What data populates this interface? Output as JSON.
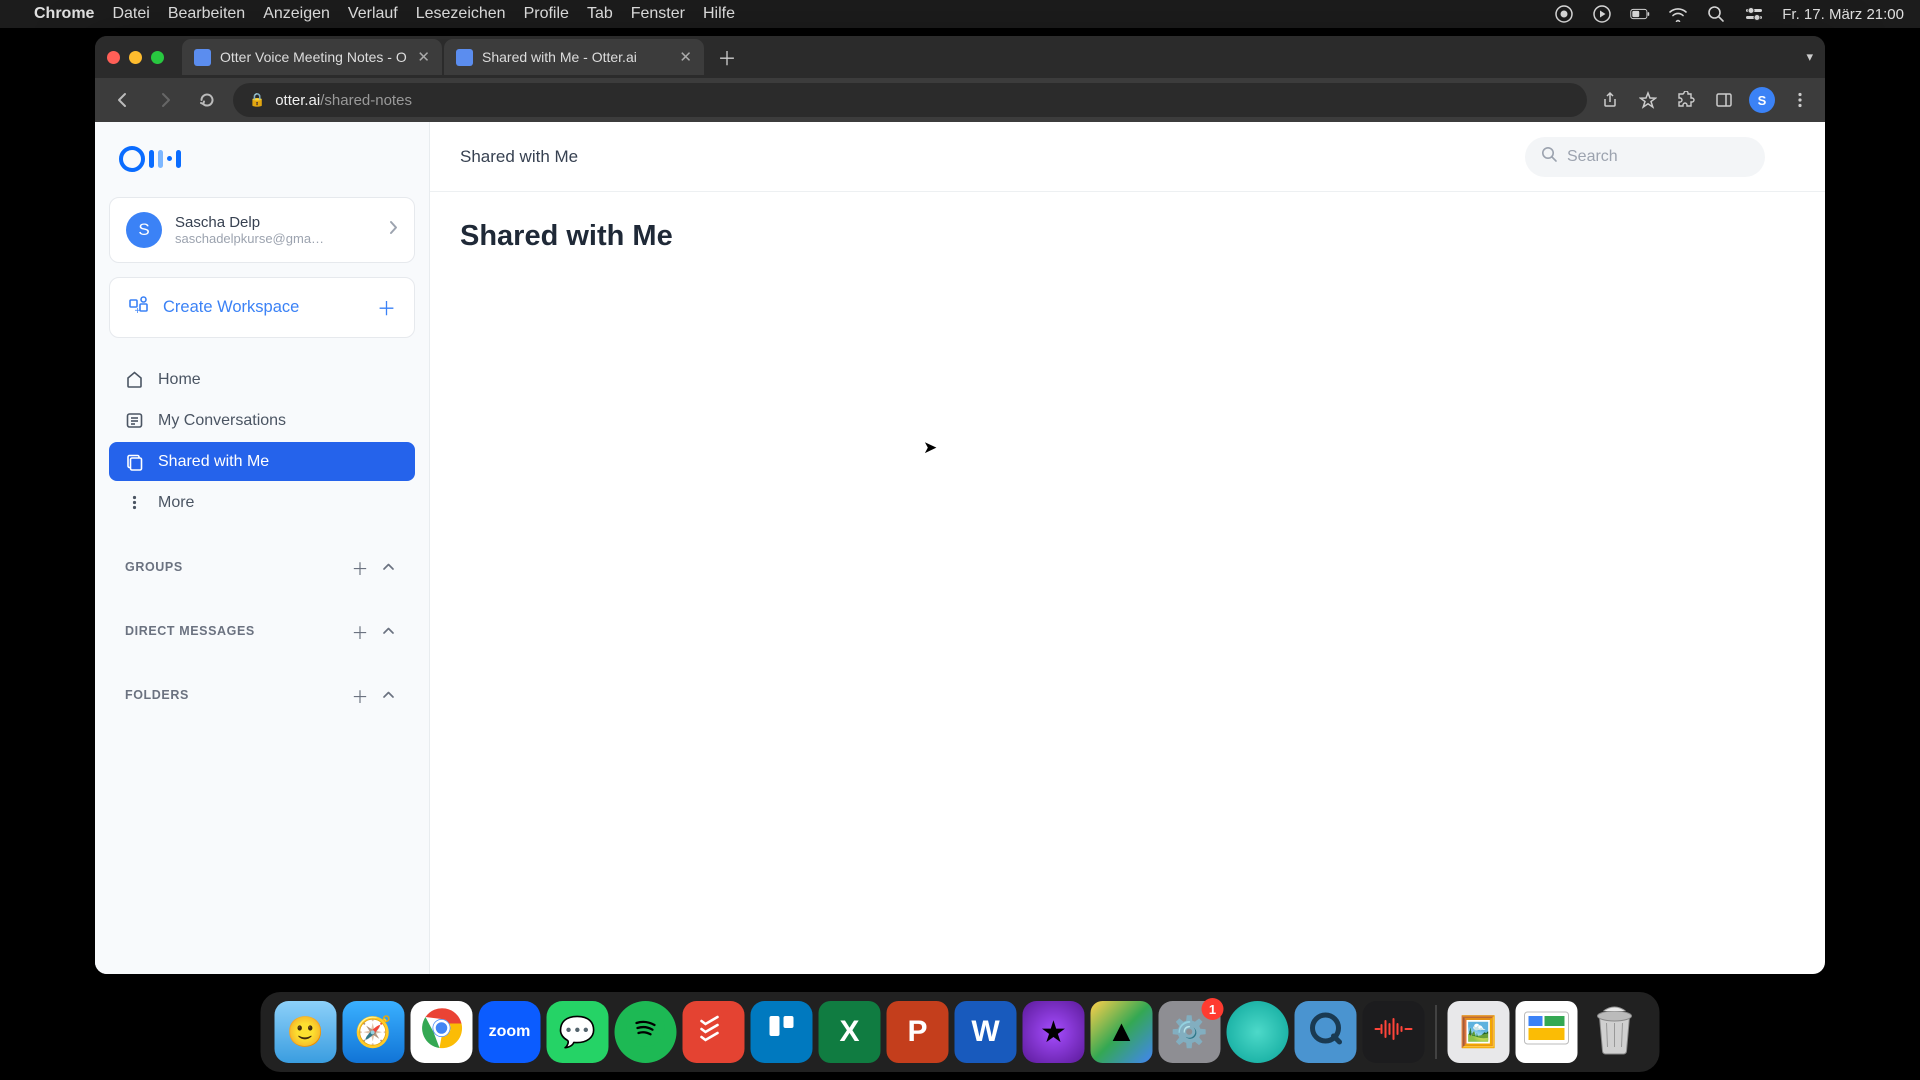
{
  "menubar": {
    "app": "Chrome",
    "items": [
      "Datei",
      "Bearbeiten",
      "Anzeigen",
      "Verlauf",
      "Lesezeichen",
      "Profile",
      "Tab",
      "Fenster",
      "Hilfe"
    ],
    "date": "Fr. 17. März  21:00"
  },
  "tabs": [
    {
      "title": "Otter Voice Meeting Notes - O"
    },
    {
      "title": "Shared with Me - Otter.ai"
    }
  ],
  "url": {
    "domain": "otter.ai",
    "path": "/shared-notes"
  },
  "profile_initial": "S",
  "sidebar": {
    "user": {
      "initial": "S",
      "name": "Sascha Delp",
      "email": "saschadelpkurse@gma…"
    },
    "workspace_label": "Create Workspace",
    "nav": [
      {
        "key": "home",
        "label": "Home"
      },
      {
        "key": "my-conversations",
        "label": "My Conversations"
      },
      {
        "key": "shared",
        "label": "Shared with Me"
      },
      {
        "key": "more",
        "label": "More"
      }
    ],
    "sections": [
      {
        "label": "GROUPS"
      },
      {
        "label": "DIRECT MESSAGES"
      },
      {
        "label": "FOLDERS"
      }
    ]
  },
  "main": {
    "breadcrumb": "Shared with Me",
    "search_placeholder": "Search",
    "heading": "Shared with Me"
  },
  "dock": {
    "badge": "1"
  }
}
